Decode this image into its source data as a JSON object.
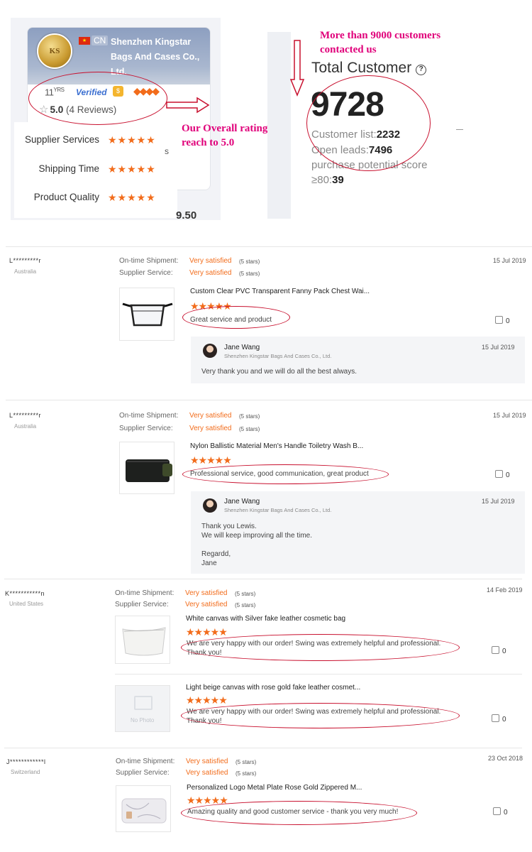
{
  "supplier": {
    "country_code": "CN",
    "name": "Shenzhen Kingstar Bags And Cases Co., Ltd.",
    "years": "11",
    "years_unit": "YRS",
    "verified_label": "Verified",
    "rating_value": "5.0",
    "reviews_text": "(4 Reviews)",
    "scores": [
      {
        "label": "Supplier Services",
        "stars": 5
      },
      {
        "label": "Shipping Time",
        "stars": 5
      },
      {
        "label": "Product Quality",
        "stars": 5
      }
    ],
    "side_fragment": "s",
    "price_fragment": "9.50"
  },
  "annotations": {
    "customers_note": "More than 9000 customers contacted us",
    "ratings_note": "Our Overall ratings reach to 5.0"
  },
  "total_customer": {
    "title": "Total Customer",
    "value": "9728",
    "customer_list_label": "Customer list:",
    "customer_list_value": "2232",
    "open_leads_label": "Open leads:",
    "open_leads_value": "7496",
    "purchase_label": "purchase potential score",
    "purchase_prefix": "≥80:",
    "purchase_value": "39"
  },
  "labels": {
    "ontime": "On-time Shipment:",
    "supplier_service": "Supplier Service:",
    "very_satisfied": "Very satisfied",
    "five_stars": "(5 stars)"
  },
  "reviews": [
    {
      "name": "L*********r",
      "country": "Australia",
      "date": "15 Jul 2019",
      "products": [
        {
          "title": "Custom Clear PVC Transparent Fanny Pack Chest Wai...",
          "comment": "Great service and product",
          "likes": "0"
        }
      ],
      "reply": {
        "name": "Jane Wang",
        "company": "Shenzhen Kingstar Bags And Cases Co., Ltd.",
        "date": "15 Jul 2019",
        "text": "Very thank you and we will do all the best always."
      }
    },
    {
      "name": "L*********r",
      "country": "Australia",
      "date": "15 Jul 2019",
      "products": [
        {
          "title": "Nylon Ballistic Material Men's Handle Toiletry Wash B...",
          "comment": "Professional service, good communication, great product",
          "likes": "0"
        }
      ],
      "reply": {
        "name": "Jane Wang",
        "company": "Shenzhen Kingstar Bags And Cases Co., Ltd.",
        "date": "15 Jul 2019",
        "text_lines": [
          "Thank you Lewis.",
          "We will keep improving all the time.",
          "",
          "Regardd,",
          "Jane"
        ]
      }
    },
    {
      "name": "K***********n",
      "country": "United States",
      "date": "14 Feb 2019",
      "products": [
        {
          "title": "White canvas with Silver fake leather cosmetic bag",
          "comment": "We are very happy with our order! Swing was extremely helpful and professional. Thank you!",
          "likes": "0"
        },
        {
          "title": "Light beige canvas with rose gold fake leather cosmet...",
          "comment": "We are very happy with our order! Swing was extremely helpful and professional. Thank you!",
          "likes": "0",
          "thumb_text": "No Photo"
        }
      ]
    },
    {
      "name": "J************l",
      "country": "Switzerland",
      "date": "23 Oct 2018",
      "products": [
        {
          "title": "Personalized Logo Metal Plate Rose Gold Zippered M...",
          "comment": "Amazing quality and good customer service - thank you very much!",
          "likes": "0"
        }
      ]
    }
  ],
  "colors": {
    "accent": "#f26c1b",
    "annotation": "#e0007a",
    "oval": "#c8102e"
  },
  "icons": [
    "star-icon",
    "help-icon",
    "thumb-up-icon",
    "verified-icon",
    "gold-supplier-icon",
    "diamond-icon",
    "arrow-icon",
    "no-photo-icon"
  ]
}
